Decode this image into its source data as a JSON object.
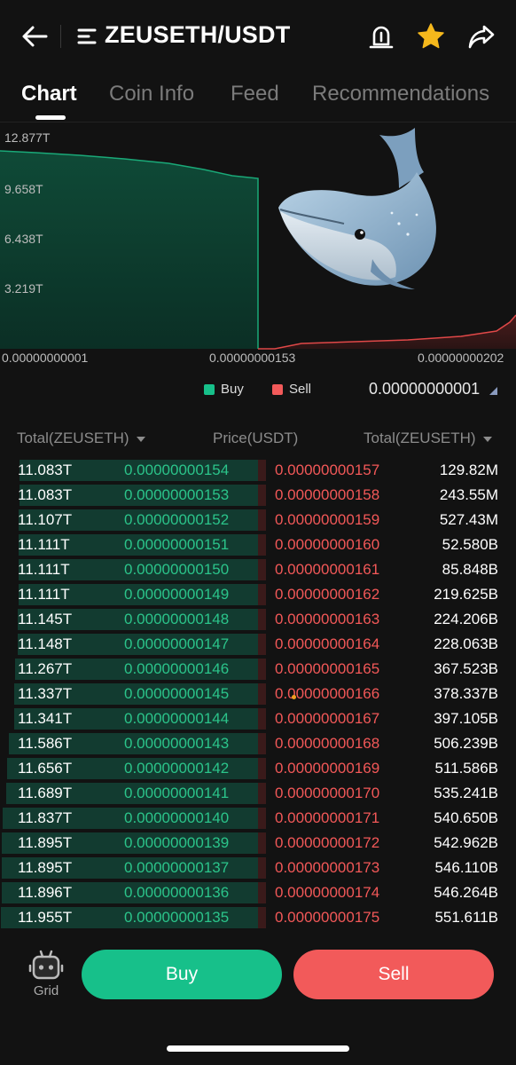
{
  "header": {
    "pair": "ZEUSETH/USDT",
    "icons": [
      "back-arrow-icon",
      "menu-icon",
      "price-alert-icon",
      "star-icon",
      "share-icon"
    ]
  },
  "tabs": [
    {
      "label": "Chart",
      "active": true
    },
    {
      "label": "Coin Info",
      "active": false
    },
    {
      "label": "Feed",
      "active": false
    },
    {
      "label": "Recommendations",
      "active": false
    }
  ],
  "depth_chart": {
    "y_ticks": [
      "12.877T",
      "9.658T",
      "6.438T",
      "3.219T"
    ],
    "x_ticks": [
      "0.00000000001",
      "0.00000000153",
      "0.00000000202"
    ],
    "legend": [
      {
        "label": "Buy",
        "color": "#17c08a"
      },
      {
        "label": "Sell",
        "color": "#f25a5a"
      }
    ],
    "precision": "0.00000000001",
    "sticker": "whale"
  },
  "book": {
    "headers": {
      "buy_total": "Total(ZEUSETH)",
      "price": "Price(USDT)",
      "sell_total": "Total(ZEUSETH)"
    },
    "rows": [
      {
        "buy_total": "11.083T",
        "buy_price": "0.00000000154",
        "sell_price": "0.00000000157",
        "sell_total": "129.82M",
        "depth": 0.925
      },
      {
        "buy_total": "11.083T",
        "buy_price": "0.00000000153",
        "sell_price": "0.00000000158",
        "sell_total": "243.55M",
        "depth": 0.925
      },
      {
        "buy_total": "11.107T",
        "buy_price": "0.00000000152",
        "sell_price": "0.00000000159",
        "sell_total": "527.43M",
        "depth": 0.927
      },
      {
        "buy_total": "11.111T",
        "buy_price": "0.00000000151",
        "sell_price": "0.00000000160",
        "sell_total": "52.580B",
        "depth": 0.927
      },
      {
        "buy_total": "11.111T",
        "buy_price": "0.00000000150",
        "sell_price": "0.00000000161",
        "sell_total": "85.848B",
        "depth": 0.927
      },
      {
        "buy_total": "11.111T",
        "buy_price": "0.00000000149",
        "sell_price": "0.00000000162",
        "sell_total": "219.625B",
        "depth": 0.927
      },
      {
        "buy_total": "11.145T",
        "buy_price": "0.00000000148",
        "sell_price": "0.00000000163",
        "sell_total": "224.206B",
        "depth": 0.93
      },
      {
        "buy_total": "11.148T",
        "buy_price": "0.00000000147",
        "sell_price": "0.00000000164",
        "sell_total": "228.063B",
        "depth": 0.93
      },
      {
        "buy_total": "11.267T",
        "buy_price": "0.00000000146",
        "sell_price": "0.00000000165",
        "sell_total": "367.523B",
        "depth": 0.94
      },
      {
        "buy_total": "11.337T",
        "buy_price": "0.00000000145",
        "sell_price": "0.00000000166",
        "sell_total": "378.337B",
        "depth": 0.946
      },
      {
        "buy_total": "11.341T",
        "buy_price": "0.00000000144",
        "sell_price": "0.00000000167",
        "sell_total": "397.105B",
        "depth": 0.946
      },
      {
        "buy_total": "11.586T",
        "buy_price": "0.00000000143",
        "sell_price": "0.00000000168",
        "sell_total": "506.239B",
        "depth": 0.967
      },
      {
        "buy_total": "11.656T",
        "buy_price": "0.00000000142",
        "sell_price": "0.00000000169",
        "sell_total": "511.586B",
        "depth": 0.972
      },
      {
        "buy_total": "11.689T",
        "buy_price": "0.00000000141",
        "sell_price": "0.00000000170",
        "sell_total": "535.241B",
        "depth": 0.975
      },
      {
        "buy_total": "11.837T",
        "buy_price": "0.00000000140",
        "sell_price": "0.00000000171",
        "sell_total": "540.650B",
        "depth": 0.988
      },
      {
        "buy_total": "11.895T",
        "buy_price": "0.00000000139",
        "sell_price": "0.00000000172",
        "sell_total": "542.962B",
        "depth": 0.993
      },
      {
        "buy_total": "11.895T",
        "buy_price": "0.00000000137",
        "sell_price": "0.00000000173",
        "sell_total": "546.110B",
        "depth": 0.993
      },
      {
        "buy_total": "11.896T",
        "buy_price": "0.00000000136",
        "sell_price": "0.00000000174",
        "sell_total": "546.264B",
        "depth": 0.993
      },
      {
        "buy_total": "11.955T",
        "buy_price": "0.00000000135",
        "sell_price": "0.00000000175",
        "sell_total": "551.611B",
        "depth": 0.998
      }
    ]
  },
  "footer": {
    "grid_label": "Grid",
    "buy_label": "Buy",
    "sell_label": "Sell"
  }
}
